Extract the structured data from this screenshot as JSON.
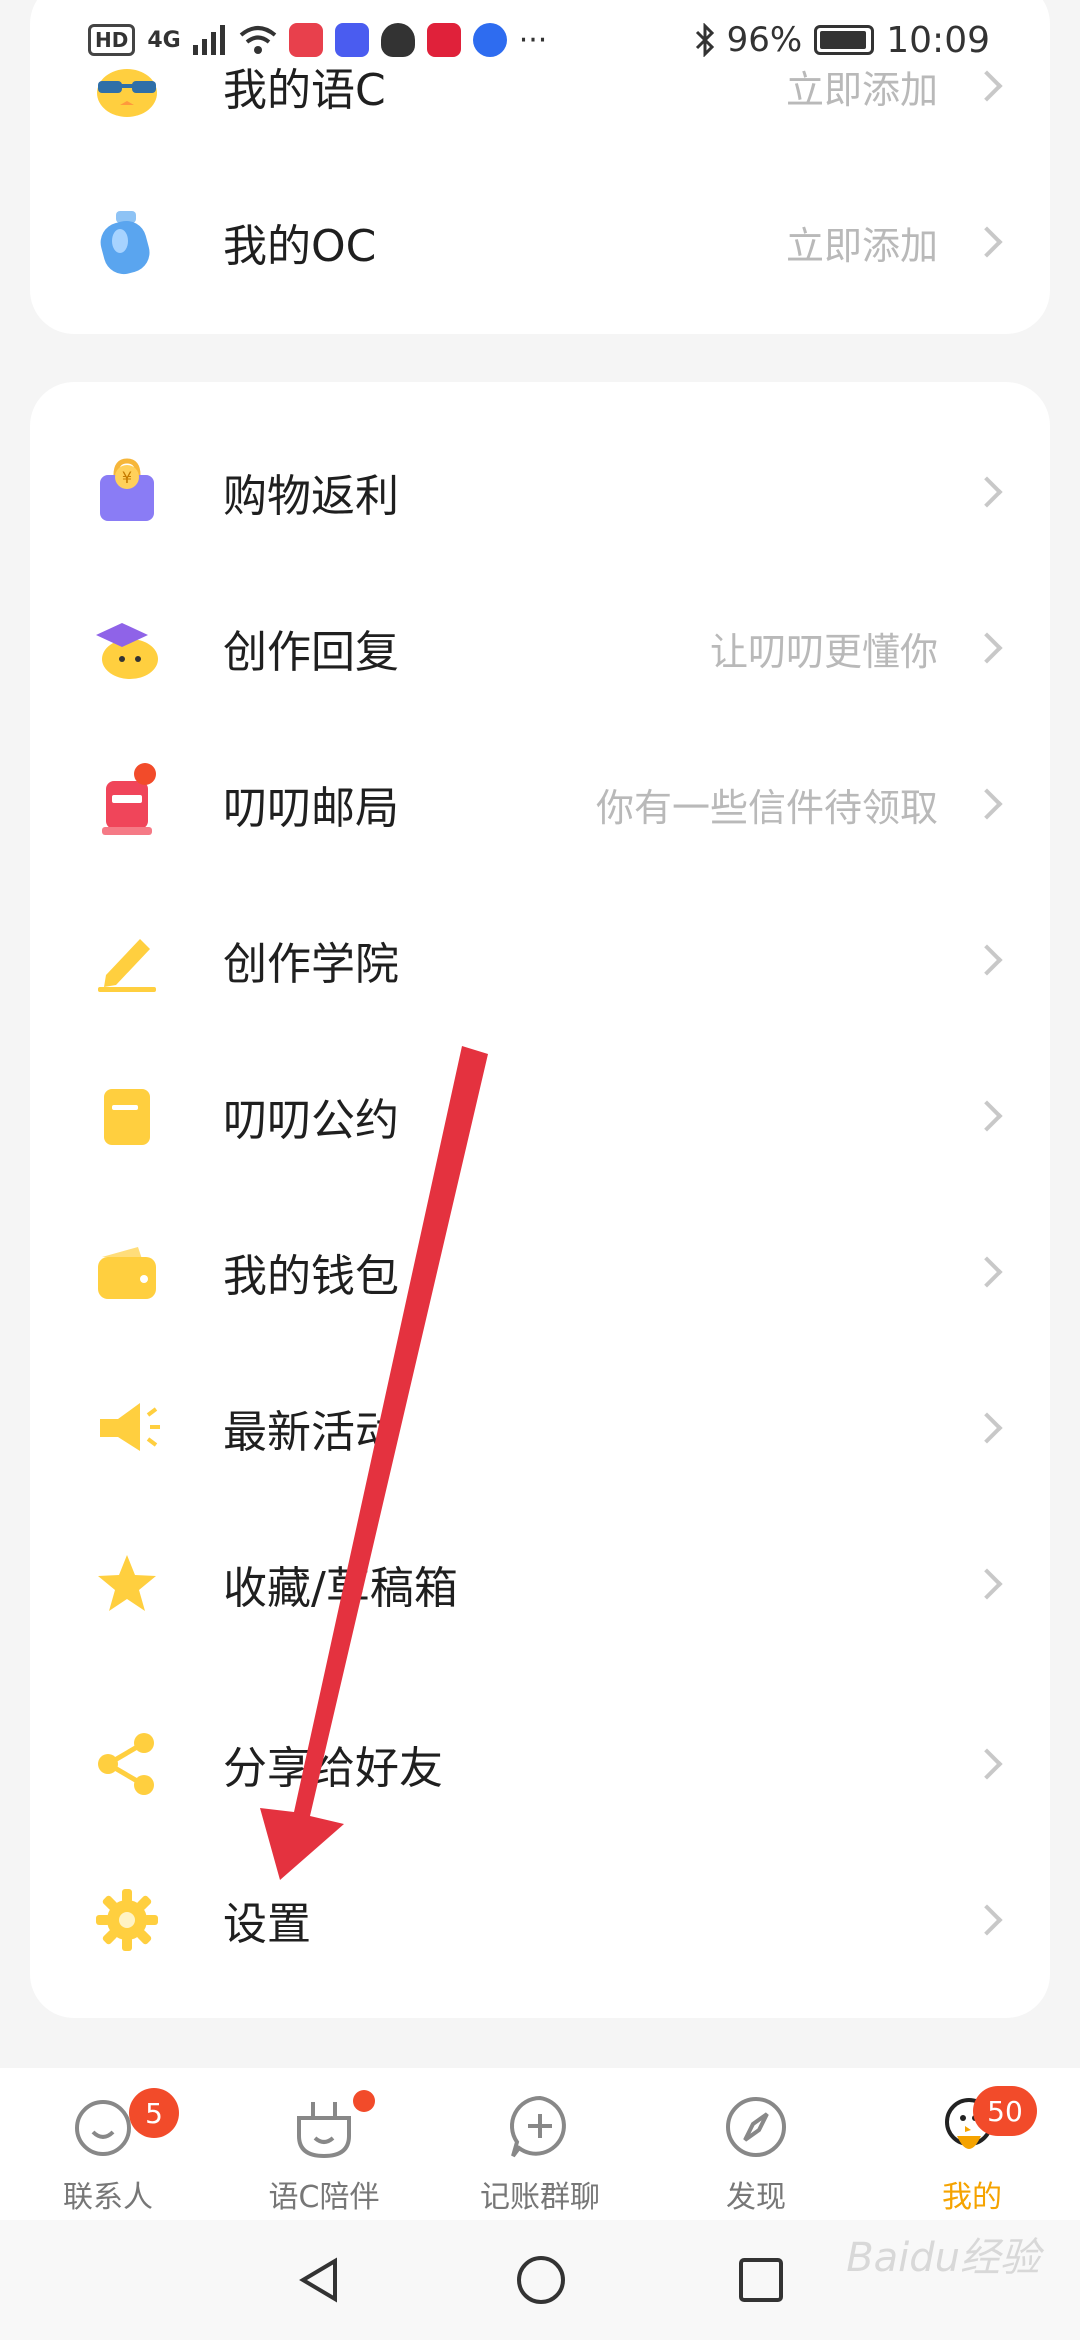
{
  "status_bar": {
    "hd": "HD",
    "network": "4G",
    "battery": "96%",
    "time": "10:09"
  },
  "top_card": {
    "items": [
      {
        "label": "我的语C",
        "hint": "立即添加",
        "icon": "glasses-chick-icon"
      },
      {
        "label": "我的OC",
        "hint": "立即添加",
        "icon": "bottle-icon"
      }
    ]
  },
  "main_card": {
    "items": [
      {
        "label": "购物返利",
        "hint": "",
        "icon": "shopping-bag-icon"
      },
      {
        "label": "创作回复",
        "hint": "让叨叨更懂你",
        "icon": "graduate-chick-icon"
      },
      {
        "label": "叨叨邮局",
        "hint": "你有一些信件待领取",
        "icon": "mailbox-icon"
      },
      {
        "label": "创作学院",
        "hint": "",
        "icon": "pencil-icon"
      },
      {
        "label": "叨叨公约",
        "hint": "",
        "icon": "notepad-icon"
      },
      {
        "label": "我的钱包",
        "hint": "",
        "icon": "wallet-icon"
      },
      {
        "label": "最新活动",
        "hint": "",
        "icon": "megaphone-icon"
      },
      {
        "label": "收藏/草稿箱",
        "hint": "",
        "icon": "star-icon"
      },
      {
        "label": "分享给好友",
        "hint": "",
        "icon": "share-icon"
      },
      {
        "label": "设置",
        "hint": "",
        "icon": "gear-icon"
      }
    ]
  },
  "tabbar": {
    "tabs": [
      {
        "label": "联系人",
        "badge": "5",
        "icon": "contacts-icon"
      },
      {
        "label": "语C陪伴",
        "badge": "",
        "icon": "companion-icon"
      },
      {
        "label": "记账群聊",
        "badge": "",
        "icon": "add-chat-icon"
      },
      {
        "label": "发现",
        "badge": "",
        "icon": "compass-icon"
      },
      {
        "label": "我的",
        "badge": "50",
        "icon": "profile-chick-icon"
      }
    ]
  },
  "watermark": "Baidu经验",
  "colors": {
    "accent": "#f5a300",
    "badge": "#f24b2a",
    "arrow": "#e4323f"
  }
}
